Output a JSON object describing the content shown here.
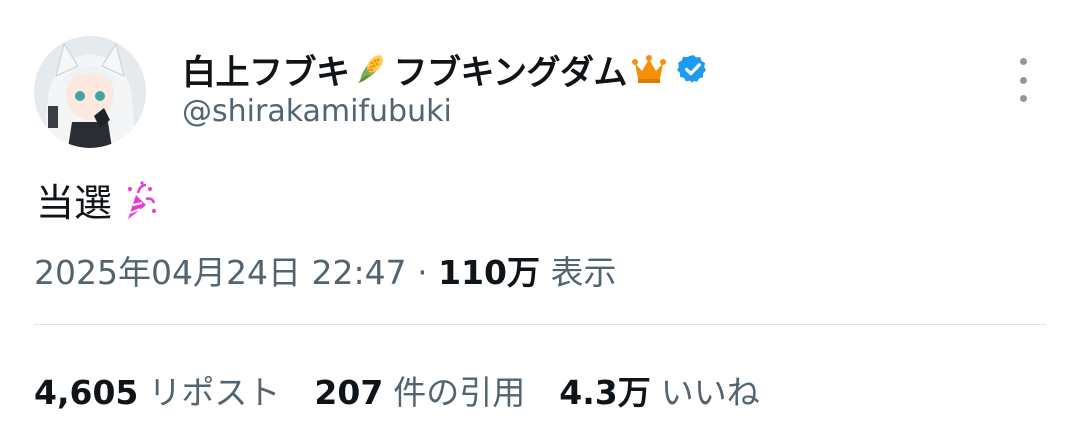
{
  "user": {
    "display_name_part1": "白上フブキ",
    "display_name_part2": "フブキングダム",
    "handle": "@shirakamifubuki",
    "emoji_1": "corn-icon",
    "emoji_2": "crown-icon",
    "verified": true,
    "verified_color": "#1d9bf0"
  },
  "tweet": {
    "text": "当選",
    "emoji": "party-popper-icon"
  },
  "meta": {
    "timestamp": "2025年04月24日 22:47",
    "separator": "·",
    "views_count": "110万",
    "views_label": "表示"
  },
  "stats": {
    "reposts_count": "4,605",
    "reposts_label": "リポスト",
    "quotes_count": "207",
    "quotes_label": "件の引用",
    "likes_count": "4.3万",
    "likes_label": "いいね"
  },
  "colors": {
    "text_primary": "#0f1419",
    "text_secondary": "#536471",
    "divider": "#dfe3e6"
  }
}
